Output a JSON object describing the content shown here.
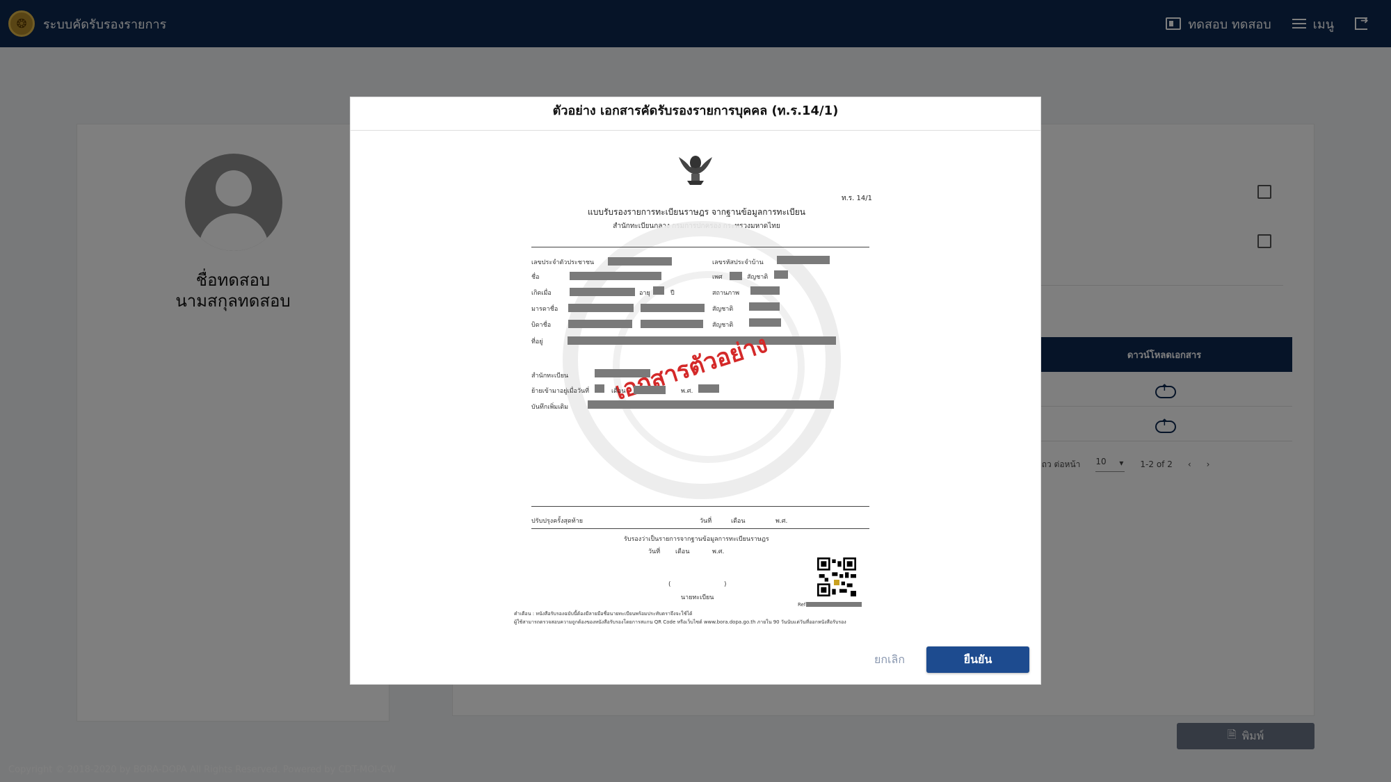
{
  "topbar": {
    "app_title": "ระบบคัดรับรองรายการ",
    "user_label": "ทดสอบ ทดสอบ",
    "menu_label": "เมนู"
  },
  "profile": {
    "first_name": "ชื่อทดสอบ",
    "last_name": "นามสกุลทดสอบ"
  },
  "table": {
    "download_header": "ดาวน์โหลดเอกสาร",
    "rows_per_page_label": "แถว ต่อหน้า",
    "rows_per_page_value": "10",
    "range_text": "1-2 of 2"
  },
  "print_button_label": "พิมพ์",
  "footer": {
    "copyright": "Copyright © 2018-2020 by BORA-DOPA All Rights Reserved. Powered by CDT-MOI-CW"
  },
  "modal": {
    "title": "ตัวอย่าง เอกสารคัดรับรองรายการบุคคล (ท.ร.14/1)",
    "cancel_label": "ยกเลิก",
    "confirm_label": "ยืนยัน"
  },
  "document": {
    "form_code": "ท.ร. 14/1",
    "heading": "แบบรับรองรายการทะเบียนราษฎร จากฐานข้อมูลการทะเบียน",
    "subheading": "สำนักทะเบียนกลาง กรมการปกครอง กระทรวงมหาดไทย",
    "stamp_text": "เอกสารตัวอย่าง",
    "fields": {
      "id_number": "เลขประจำตัวประชาชน",
      "house_code": "เลขรหัสประจำบ้าน",
      "name": "ชื่อ",
      "sex": "เพศ",
      "nationality": "สัญชาติ",
      "birth_date": "เกิดเมื่อ",
      "age": "อายุ",
      "years": "ปี",
      "status": "สถานภาพ",
      "mother_name": "มารดาชื่อ",
      "mother_nationality": "สัญชาติ",
      "father_name": "บิดาชื่อ",
      "father_nationality": "สัญชาติ",
      "address": "ที่อยู่",
      "registry_office": "สำนักทะเบียน",
      "move_in_date": "ย้ายเข้ามาอยู่เมื่อวันที่",
      "month": "เดือน",
      "year": "พ.ศ.",
      "remarks": "บันทึกเพิ่มเติม",
      "last_update": "ปรับปรุงครั้งสุดท้าย",
      "day": "วันที่",
      "certify_line": "รับรองว่าเป็นรายการจากฐานข้อมูลการทะเบียนราษฎร",
      "registrar": "นายทะเบียน",
      "sign_open": "(",
      "sign_close": ")",
      "ref": "Ref"
    },
    "note1": "คำเตือน : หนังสือรับรองฉบับนี้ต้องมีลายมือชื่อนายทะเบียนพร้อมประทับตราจึงจะใช้ได้",
    "note2": "ผู้ใช้สามารถตรวจสอบความถูกต้องของหนังสือรับรองโดยการสแกน QR Code หรือเว็บไซต์ www.bora.dopa.go.th ภายใน 90 วันนับแต่วันที่ออกหนังสือรับรอง"
  },
  "colors": {
    "navbar": "#0d2851",
    "primary_button": "#1d4b8f",
    "stamp_red": "#d42929"
  },
  "icons": {
    "logo": "dopa-emblem",
    "user": "id-card-icon",
    "menu": "hamburger-menu-icon",
    "logout": "logout-icon",
    "download": "cloud-upload-icon",
    "print": "document-icon"
  }
}
